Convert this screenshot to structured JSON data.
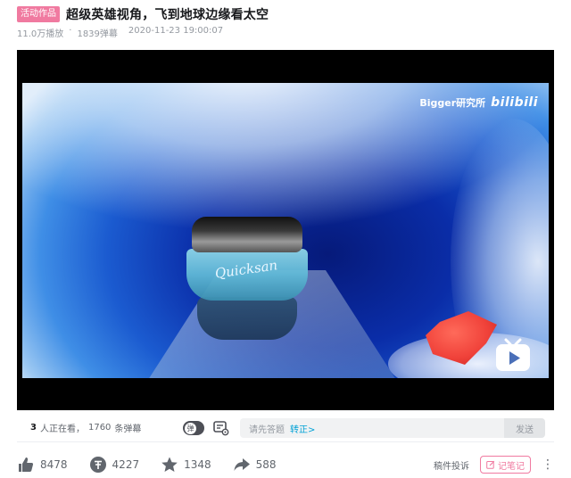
{
  "header": {
    "badge": "活动作品",
    "title": "超级英雄视角，飞到地球边缘看太空"
  },
  "meta": {
    "views": "11.0万播放",
    "separator": "·",
    "danmaku_count": "1839弹幕",
    "datetime": "2020-11-23 19:00:07"
  },
  "video": {
    "watermark_channel": "Bigger研究所",
    "watermark_logo": "bilibili",
    "jar_label": "Quicksan"
  },
  "danmaku_bar": {
    "watching_count": "3",
    "watching_label": "人正在看，",
    "danmaku_total": "1760",
    "danmaku_label": "条弹幕",
    "toggle_label": "弹",
    "input_placeholder": "请先答题",
    "input_link": "转正>",
    "send_label": "发送"
  },
  "actions": {
    "like": "8478",
    "coin": "4227",
    "favorite": "1348",
    "share": "588",
    "report_label": "稿件投诉",
    "note_label": "记笔记"
  },
  "colors": {
    "accent_pink": "#f07aa0",
    "link_blue": "#00a1d6",
    "icon_gray": "#61666d"
  }
}
